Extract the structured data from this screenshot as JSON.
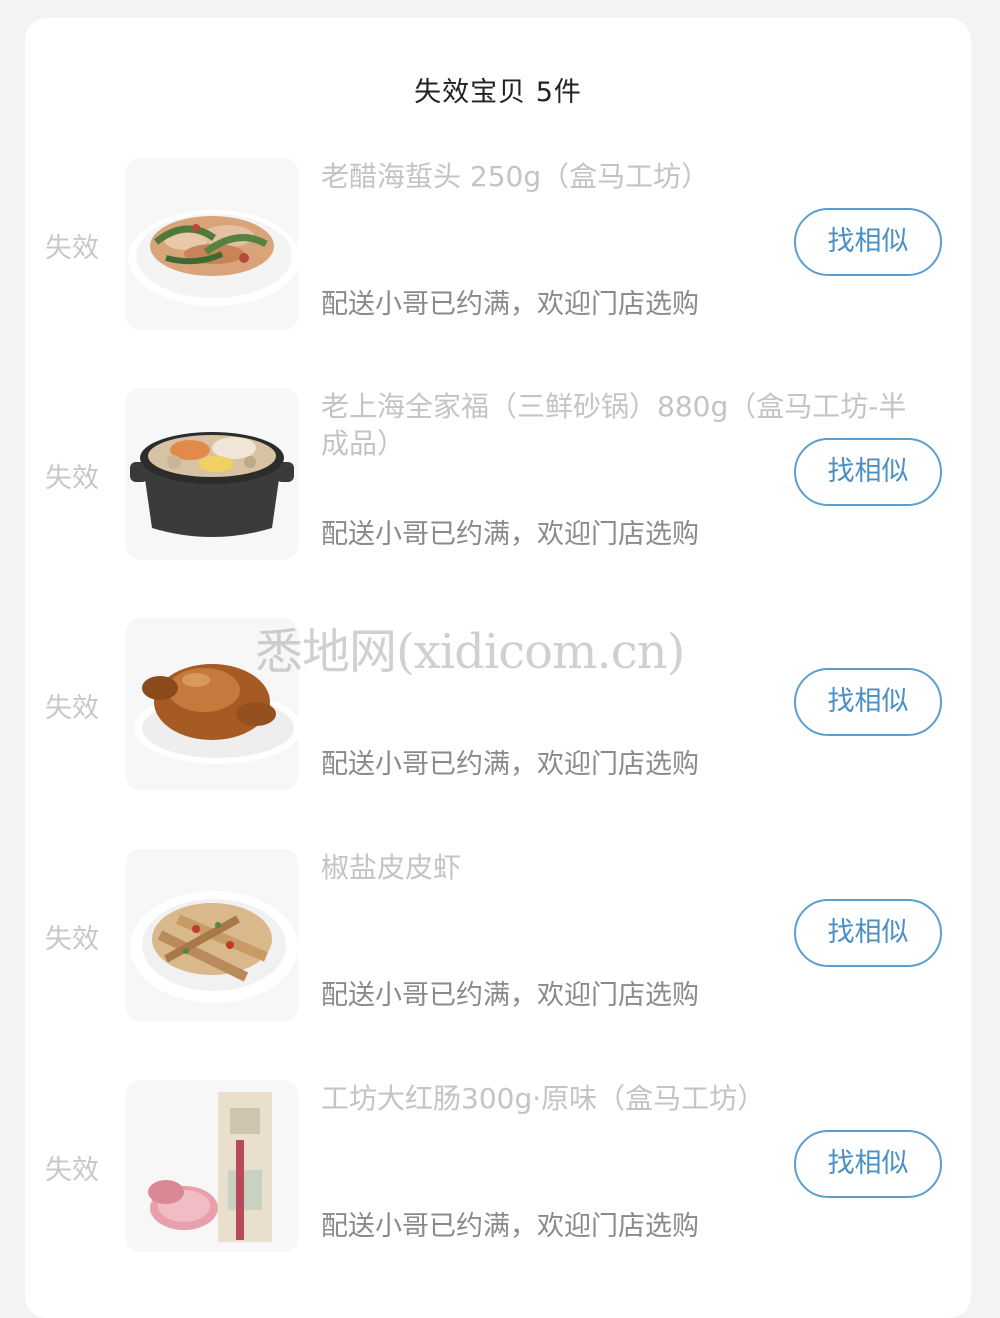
{
  "header": {
    "title": "失效宝贝 5件"
  },
  "items": [
    {
      "status": "失效",
      "name": "老醋海蜇头 250g（盒马工坊）",
      "subtitle": "配送小哥已约满，欢迎门店选购",
      "button": "找相似",
      "image": "jellyfish-salad-dish"
    },
    {
      "status": "失效",
      "name": "老上海全家福（三鲜砂锅）880g（盒马工坊-半成品）",
      "subtitle": "配送小哥已约满，欢迎门店选购",
      "button": "找相似",
      "image": "claypot-stew"
    },
    {
      "status": "失效",
      "name": "",
      "subtitle": "配送小哥已约满，欢迎门店选购",
      "button": "找相似",
      "image": "roast-chicken"
    },
    {
      "status": "失效",
      "name": "椒盐皮皮虾",
      "subtitle": "配送小哥已约满，欢迎门店选购",
      "button": "找相似",
      "image": "salt-pepper-shrimp"
    },
    {
      "status": "失效",
      "name": "工坊大红肠300g·原味（盒马工坊）",
      "subtitle": "配送小哥已约满，欢迎门店选购",
      "button": "找相似",
      "image": "red-sausage-pack"
    }
  ],
  "watermark": "悉地网(xidicom.cn)"
}
